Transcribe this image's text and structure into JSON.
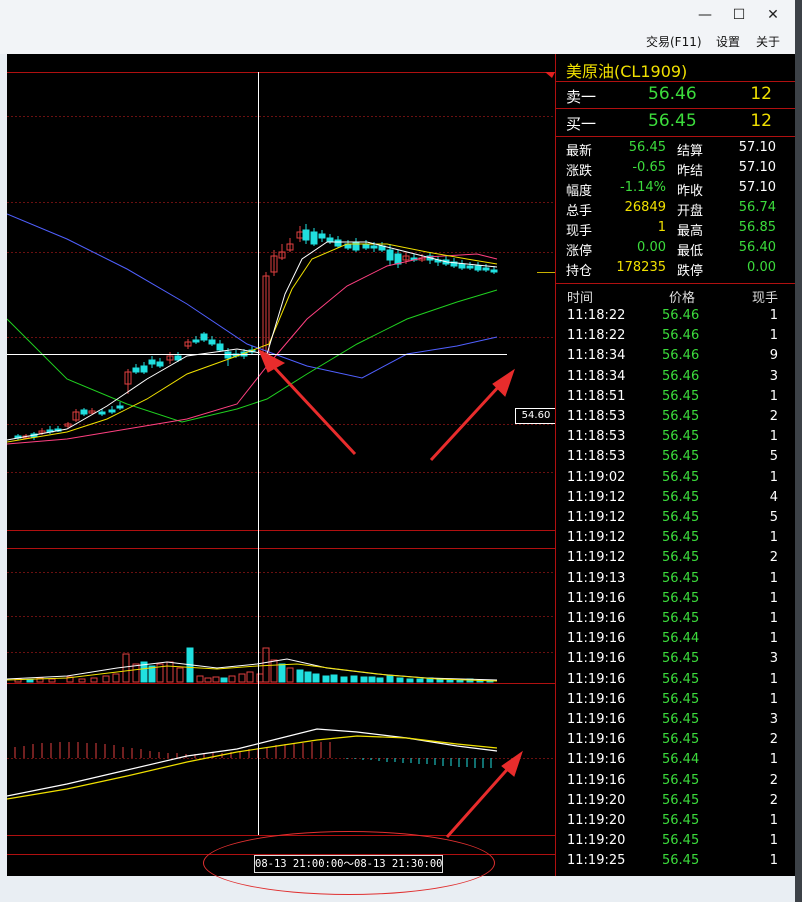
{
  "window": {
    "minimize": "—",
    "maximize": "☐",
    "close": "✕"
  },
  "menu": {
    "trade": "交易(F11)",
    "settings": "设置",
    "about": "关于"
  },
  "chart": {
    "price_tag": "54.60",
    "time_range": "08-13  21:00:00～08-13 21:30:00",
    "colors": {
      "up": "#e04040",
      "down": "#20e0e0",
      "ma5": "#ffffff",
      "ma10": "#f0e000",
      "ma20": "#ff4080",
      "ma30": "#20d020",
      "ma60": "#5060ff"
    }
  },
  "quote": {
    "symbol": "美原油(CL1909)",
    "ask": {
      "label": "卖一",
      "price": "56.46",
      "volume": "12"
    },
    "bid": {
      "label": "买一",
      "price": "56.45",
      "volume": "12"
    },
    "stats": [
      {
        "l1": "最新",
        "v1": "56.45",
        "c1": "g",
        "l2": "结算",
        "v2": "57.10",
        "c2": "w"
      },
      {
        "l1": "涨跌",
        "v1": "-0.65",
        "c1": "g",
        "l2": "昨结",
        "v2": "57.10",
        "c2": "w"
      },
      {
        "l1": "幅度",
        "v1": "-1.14%",
        "c1": "g",
        "l2": "昨收",
        "v2": "57.10",
        "c2": "w"
      },
      {
        "l1": "总手",
        "v1": "26849",
        "c1": "y",
        "l2": "开盘",
        "v2": "56.74",
        "c2": "g"
      },
      {
        "l1": "现手",
        "v1": "1",
        "c1": "y",
        "l2": "最高",
        "v2": "56.85",
        "c2": "g"
      },
      {
        "l1": "涨停",
        "v1": "0.00",
        "c1": "g",
        "l2": "最低",
        "v2": "56.40",
        "c2": "g"
      },
      {
        "l1": "持仓",
        "v1": "178235",
        "c1": "y",
        "l2": "跌停",
        "v2": "0.00",
        "c2": "g"
      }
    ],
    "ticks_header": {
      "time": "时间",
      "price": "价格",
      "volume": "现手"
    },
    "ticks": [
      [
        "11:18:22",
        "56.46",
        "1"
      ],
      [
        "11:18:22",
        "56.46",
        "1"
      ],
      [
        "11:18:34",
        "56.46",
        "9"
      ],
      [
        "11:18:34",
        "56.46",
        "3"
      ],
      [
        "11:18:51",
        "56.45",
        "1"
      ],
      [
        "11:18:53",
        "56.45",
        "2"
      ],
      [
        "11:18:53",
        "56.45",
        "1"
      ],
      [
        "11:18:53",
        "56.45",
        "5"
      ],
      [
        "11:19:02",
        "56.45",
        "1"
      ],
      [
        "11:19:12",
        "56.45",
        "4"
      ],
      [
        "11:19:12",
        "56.45",
        "5"
      ],
      [
        "11:19:12",
        "56.45",
        "1"
      ],
      [
        "11:19:12",
        "56.45",
        "2"
      ],
      [
        "11:19:13",
        "56.45",
        "1"
      ],
      [
        "11:19:16",
        "56.45",
        "1"
      ],
      [
        "11:19:16",
        "56.45",
        "1"
      ],
      [
        "11:19:16",
        "56.44",
        "1"
      ],
      [
        "11:19:16",
        "56.45",
        "3"
      ],
      [
        "11:19:16",
        "56.45",
        "1"
      ],
      [
        "11:19:16",
        "56.45",
        "1"
      ],
      [
        "11:19:16",
        "56.45",
        "3"
      ],
      [
        "11:19:16",
        "56.45",
        "2"
      ],
      [
        "11:19:16",
        "56.44",
        "1"
      ],
      [
        "11:19:16",
        "56.45",
        "2"
      ],
      [
        "11:19:20",
        "56.45",
        "2"
      ],
      [
        "11:19:20",
        "56.45",
        "1"
      ],
      [
        "11:19:20",
        "56.45",
        "1"
      ],
      [
        "11:19:25",
        "56.45",
        "1"
      ]
    ]
  }
}
